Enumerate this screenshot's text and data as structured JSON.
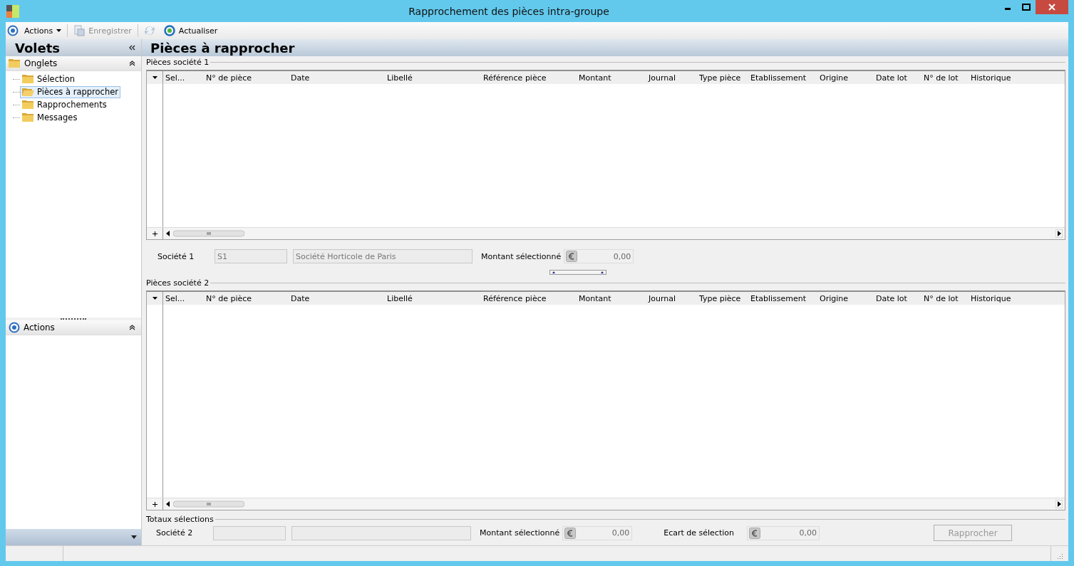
{
  "window": {
    "title": "Rapprochement des pièces intra-groupe"
  },
  "toolbar": {
    "items": [
      {
        "kind": "menu",
        "label": "Actions",
        "disabled": false
      },
      {
        "kind": "save",
        "label": "Enregistrer",
        "disabled": true
      },
      {
        "kind": "sync",
        "disabled": true
      },
      {
        "kind": "refresh",
        "label": "Actualiser",
        "disabled": false
      }
    ]
  },
  "sidebar": {
    "title": "Volets",
    "sections": [
      {
        "kind": "folder",
        "title": "Onglets",
        "expanded": true,
        "items": [
          {
            "label": "Sélection",
            "selected": false
          },
          {
            "label": "Pièces à rapprocher",
            "selected": true
          },
          {
            "label": "Rapprochements",
            "selected": false
          },
          {
            "label": "Messages",
            "selected": false
          }
        ]
      },
      {
        "kind": "actions",
        "title": "Actions",
        "expanded": true
      }
    ]
  },
  "main": {
    "title": "Pièces à rapprocher",
    "grids": [
      {
        "group_title": "Pièces société 1",
        "columns": [
          "Sel...",
          "N° de pièce",
          "Date",
          "Libellé",
          "Référence pièce",
          "Montant",
          "Journal",
          "Type pièce",
          "Etablissement",
          "Origine",
          "Date lot",
          "N° de lot",
          "Historique"
        ]
      },
      {
        "group_title": "Pièces société 2",
        "columns": [
          "Sel...",
          "N° de pièce",
          "Date",
          "Libellé",
          "Référence pièce",
          "Montant",
          "Journal",
          "Type pièce",
          "Etablissement",
          "Origine",
          "Date lot",
          "N° de lot",
          "Historique"
        ]
      }
    ],
    "company_1": {
      "label": "Société 1",
      "code": "S1",
      "name": "Société Horticole de Paris",
      "amount_label": "Montant sélectionné",
      "amount": "0,00"
    },
    "totals": {
      "group_title": "Totaux sélections",
      "label": "Société 2",
      "amount_label": "Montant sélectionné",
      "amount": "0,00",
      "gap_label": "Ecart de sélection",
      "gap": "0,00",
      "button": {
        "label": "Rapprocher",
        "disabled": true
      }
    }
  }
}
